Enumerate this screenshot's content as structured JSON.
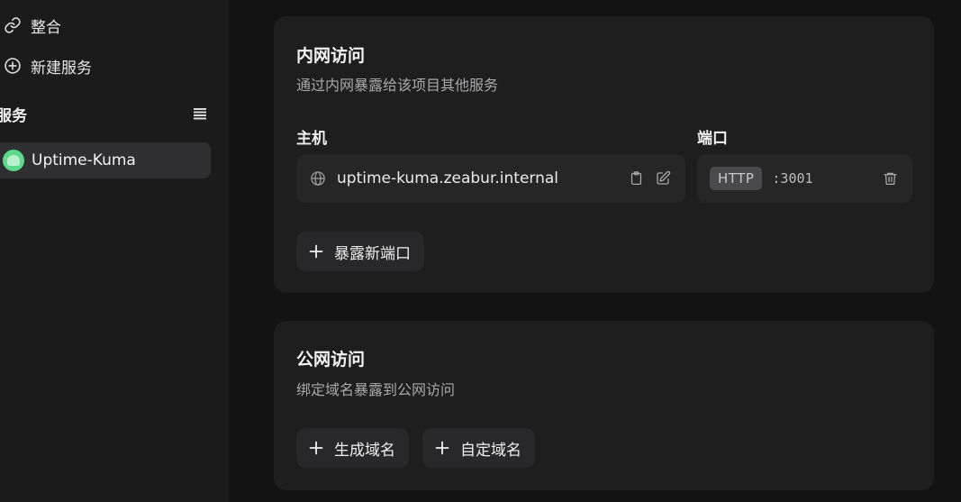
{
  "sidebar": {
    "items": [
      {
        "label": "整合",
        "icon": "link-icon"
      },
      {
        "label": "新建服务",
        "icon": "plus-circle-icon"
      }
    ],
    "section_title": "服务",
    "services": [
      {
        "label": "Uptime-Kuma",
        "icon": "uptime-kuma-logo"
      }
    ]
  },
  "private_network": {
    "title": "内网访问",
    "subtitle": "通过内网暴露给该项目其他服务",
    "host_label": "主机",
    "port_label": "端口",
    "host_value": "uptime-kuma.zeabur.internal",
    "protocol": "HTTP",
    "port_value": ":3001",
    "expose_button": "暴露新端口"
  },
  "public_network": {
    "title": "公网访问",
    "subtitle": "绑定域名暴露到公网访问",
    "generate_button": "生成域名",
    "custom_button": "自定域名"
  },
  "colors": {
    "background": "#131313",
    "sidebar": "#1b1b1c",
    "card": "#1e1e1f",
    "service_accent": "#5cd98a"
  }
}
